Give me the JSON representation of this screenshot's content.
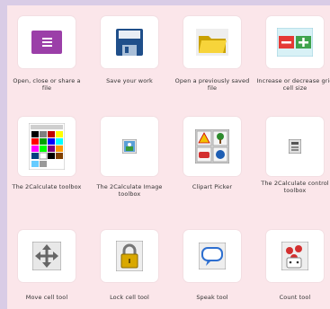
{
  "tools": [
    {
      "icon": "menu-icon",
      "label": "Open, close or share a file"
    },
    {
      "icon": "save-icon",
      "label": "Save your work"
    },
    {
      "icon": "folder-icon",
      "label": "Open a previously saved file"
    },
    {
      "icon": "zoom-cell-size-icon",
      "label": "Increase or decrease grid cell size"
    },
    {
      "icon": "color-palette-icon",
      "label": "The 2Calculate toolbox"
    },
    {
      "icon": "image-toolbox-icon",
      "label": "The 2Calculate Image toolbox"
    },
    {
      "icon": "clipart-icon",
      "label": "Clipart Picker"
    },
    {
      "icon": "control-toolbox-icon",
      "label": "The 2Calculate control toolbox"
    },
    {
      "icon": "move-arrows-icon",
      "label": "Move cell tool"
    },
    {
      "icon": "lock-icon",
      "label": "Lock cell tool"
    },
    {
      "icon": "speech-bubble-icon",
      "label": "Speak tool"
    },
    {
      "icon": "count-dice-icon",
      "label": "Count tool"
    }
  ]
}
